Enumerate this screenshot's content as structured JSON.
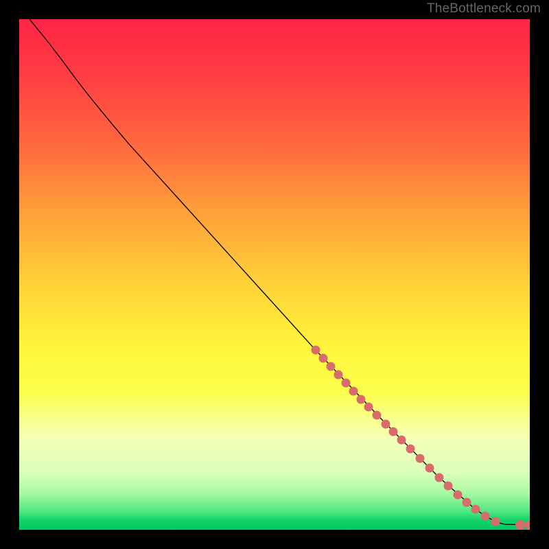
{
  "attribution": "TheBottleneck.com",
  "chart_data": {
    "type": "line",
    "title": "",
    "xlabel": "",
    "ylabel": "",
    "xlim": [
      0,
      100
    ],
    "ylim": [
      0,
      100
    ],
    "curve": "Monotone decreasing convex curve from upper-left to lower-right, flattening near x~100",
    "series": [
      {
        "name": "curve",
        "x": [
          0,
          5,
          10,
          20,
          30,
          40,
          50,
          60,
          70,
          80,
          90,
          95,
          98,
          100
        ],
        "y": [
          100,
          97,
          92,
          82,
          72,
          62,
          52,
          42,
          32,
          22,
          12,
          6,
          2.5,
          2
        ]
      },
      {
        "name": "points",
        "x": [
          57,
          59,
          60.5,
          62,
          63.5,
          65,
          66.5,
          68,
          70,
          72,
          73.5,
          75,
          77,
          79,
          81,
          83,
          85,
          87,
          89,
          91,
          93,
          95,
          99,
          101
        ],
        "y": [
          45,
          43,
          41,
          39.5,
          38,
          36.5,
          35,
          33.5,
          32,
          30,
          28.5,
          27,
          25,
          23,
          21,
          19,
          17,
          15,
          13,
          11,
          9,
          6.5,
          2.2,
          2
        ]
      }
    ]
  }
}
